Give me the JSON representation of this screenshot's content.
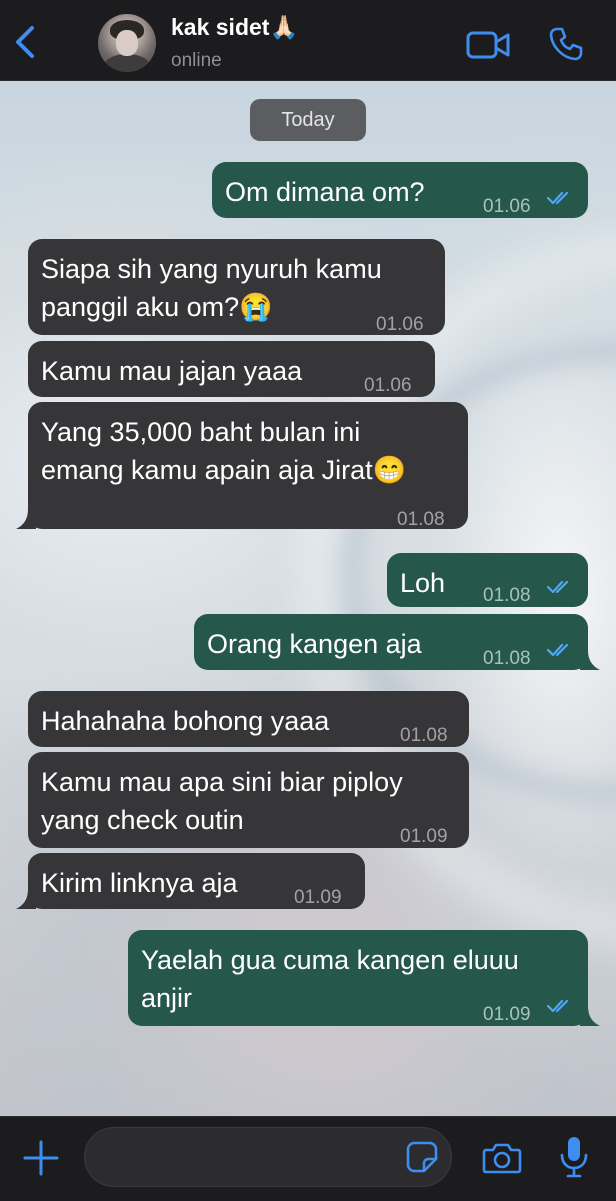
{
  "header": {
    "back_icon": "chevron-left-icon",
    "contact_name": "kak sidet",
    "contact_emoji": "🙏🏻",
    "status": "online",
    "video_icon": "video-camera-icon",
    "call_icon": "phone-icon"
  },
  "date_separator": "Today",
  "messages": [
    {
      "dir": "out",
      "lines": [
        "Om dimana om?"
      ],
      "time": "01.06",
      "read": true
    },
    {
      "dir": "in",
      "lines": [
        "Siapa sih yang nyuruh kamu",
        "panggil aku om?😭"
      ],
      "time": "01.06"
    },
    {
      "dir": "in",
      "lines": [
        "Kamu mau jajan yaaa"
      ],
      "time": "01.06"
    },
    {
      "dir": "in",
      "lines": [
        "Yang 35,000 baht bulan ini",
        "emang kamu apain aja Jirat😁"
      ],
      "time": "01.08"
    },
    {
      "dir": "out",
      "lines": [
        "Loh"
      ],
      "time": "01.08",
      "read": true
    },
    {
      "dir": "out",
      "lines": [
        "Orang kangen aja"
      ],
      "time": "01.08",
      "read": true
    },
    {
      "dir": "in",
      "lines": [
        "Hahahaha bohong yaaa"
      ],
      "time": "01.08"
    },
    {
      "dir": "in",
      "lines": [
        "Kamu mau apa sini biar piploy",
        "yang check outin"
      ],
      "time": "01.09"
    },
    {
      "dir": "in",
      "lines": [
        "Kirim linknya aja"
      ],
      "time": "01.09"
    },
    {
      "dir": "out",
      "lines": [
        "Yaelah gua cuma kangen eluuu",
        "anjir"
      ],
      "time": "01.09",
      "read": true
    }
  ],
  "composer": {
    "value": "",
    "plus_icon": "plus-icon",
    "sticker_icon": "sticker-icon",
    "camera_icon": "camera-icon",
    "mic_icon": "microphone-icon"
  },
  "colors": {
    "accent": "#3d8ef0",
    "incoming_bubble": "#363638",
    "outgoing_bubble": "#25574a",
    "read_ticks": "#4fa8f5"
  }
}
